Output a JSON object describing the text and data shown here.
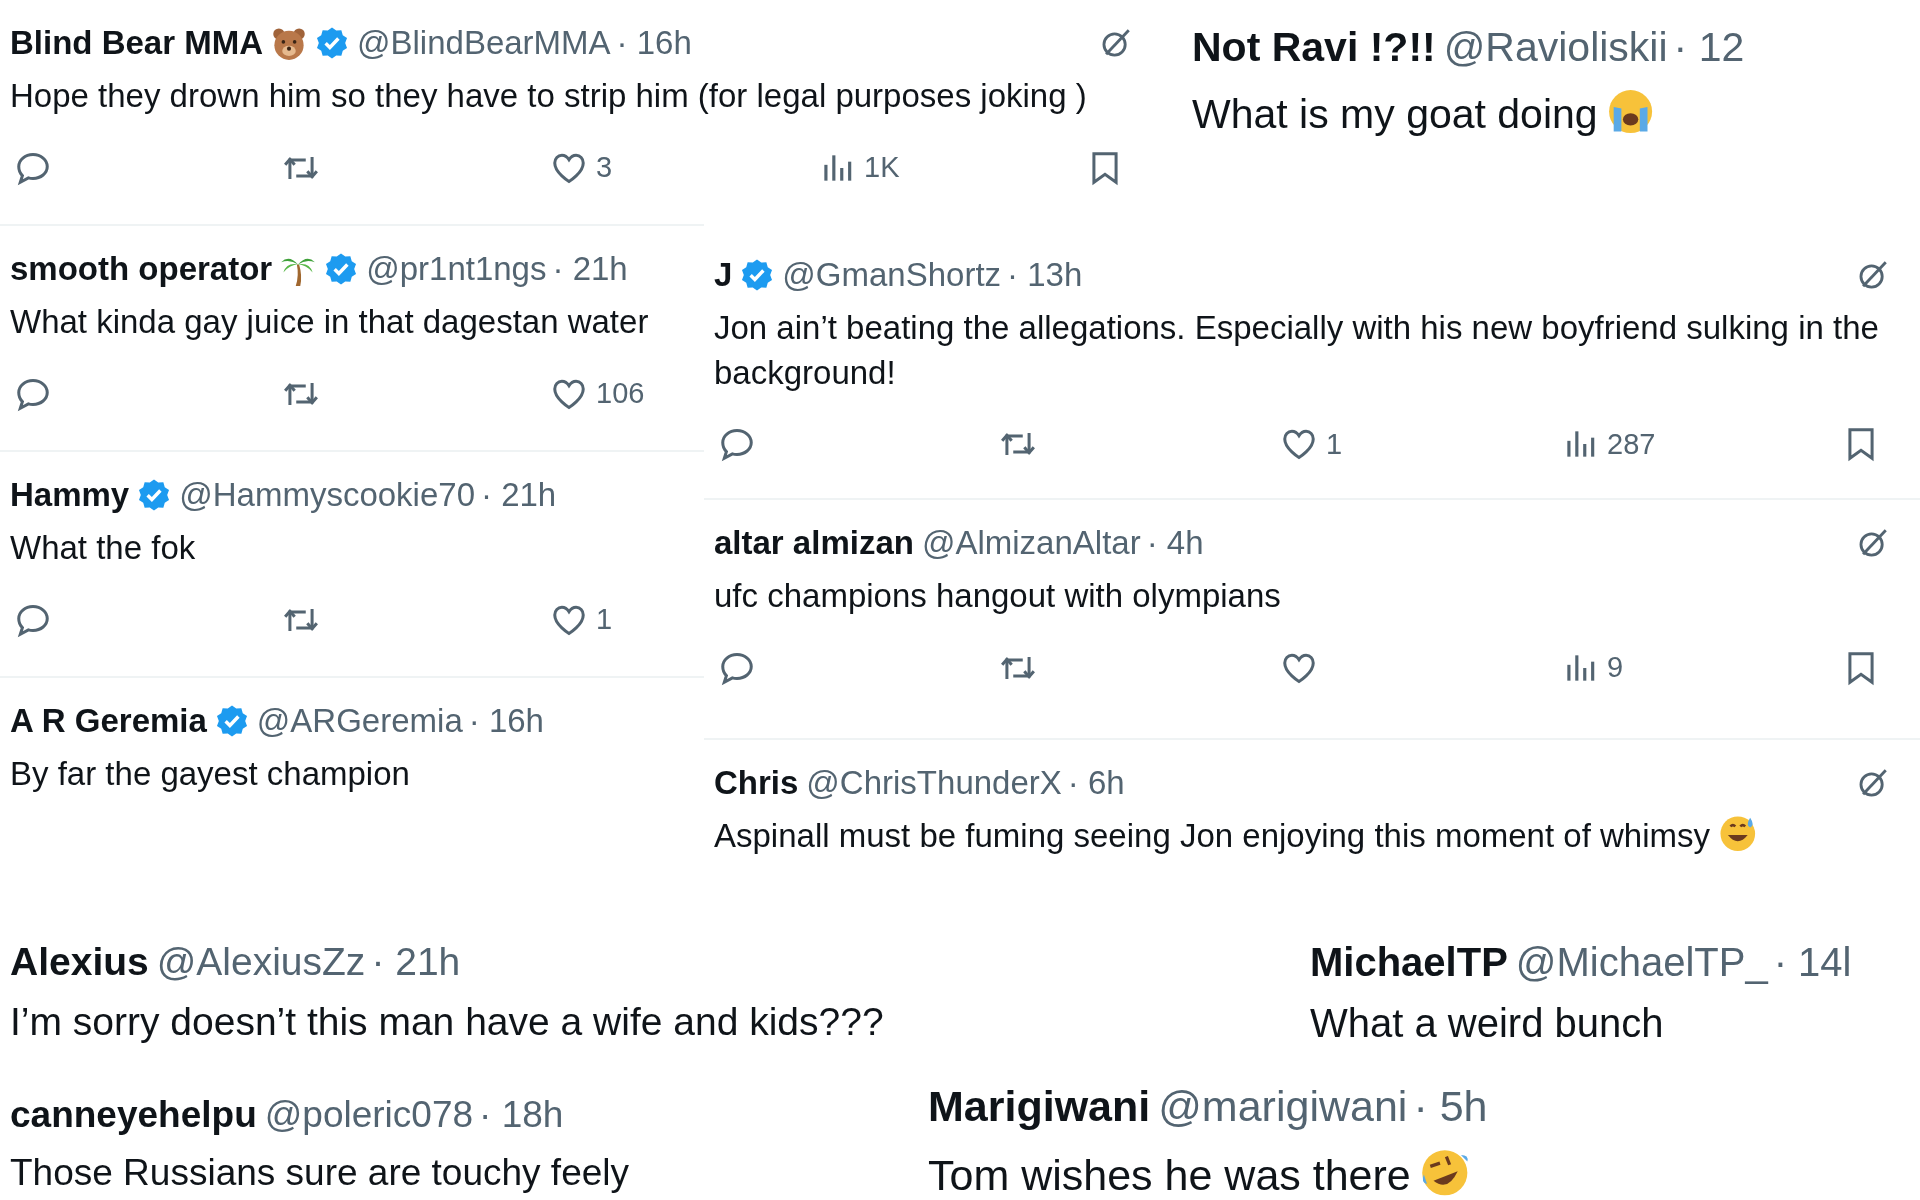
{
  "posts": [
    {
      "name": "Blind Bear MMA",
      "name_emoji": {
        "kind": "bear"
      },
      "verified": true,
      "handle": "@BlindBearMMA",
      "time": "· 16h",
      "grok": true,
      "text": "Hope they drown him so they have to strip him (for legal purposes joking )",
      "actions": [
        {
          "kind": "reply"
        },
        {
          "kind": "repost"
        },
        {
          "kind": "like",
          "count": "3"
        },
        {
          "kind": "views",
          "count": "1K"
        },
        {
          "kind": "bookmark"
        }
      ]
    },
    {
      "name": "Not Ravi !?!!",
      "verified": false,
      "handle": "@Ravioliskii",
      "time": "· 12",
      "grok": false,
      "text": "What is my goat doing",
      "text_emoji": {
        "kind": "crying"
      }
    },
    {
      "name": "smooth operator",
      "name_emoji": {
        "kind": "palm"
      },
      "verified": true,
      "handle": "@pr1nt1ngs",
      "time": "· 21h",
      "grok": false,
      "text": "What kinda gay juice in that dagestan water",
      "actions": [
        {
          "kind": "reply"
        },
        {
          "kind": "repost"
        },
        {
          "kind": "like",
          "count": "106"
        }
      ]
    },
    {
      "name": "J",
      "verified": true,
      "handle": "@GmanShortz",
      "time": "· 13h",
      "grok": true,
      "text": "Jon ain’t beating the allegations. Especially with his new boyfriend sulking in the background!",
      "actions": [
        {
          "kind": "reply"
        },
        {
          "kind": "repost"
        },
        {
          "kind": "like",
          "count": "1"
        },
        {
          "kind": "views",
          "count": "287"
        },
        {
          "kind": "bookmark"
        }
      ]
    },
    {
      "name": "Hammy",
      "verified": true,
      "handle": "@Hammyscookie70",
      "time": "· 21h",
      "grok": false,
      "text": "What the fok",
      "actions": [
        {
          "kind": "reply"
        },
        {
          "kind": "repost"
        },
        {
          "kind": "like",
          "count": "1"
        }
      ]
    },
    {
      "name": "altar almizan",
      "verified": false,
      "handle": "@AlmizanAltar",
      "time": "· 4h",
      "grok": true,
      "text": "ufc champions hangout with olympians",
      "actions": [
        {
          "kind": "reply"
        },
        {
          "kind": "repost"
        },
        {
          "kind": "like"
        },
        {
          "kind": "views",
          "count": "9"
        },
        {
          "kind": "bookmark"
        }
      ]
    },
    {
      "name": "A R Geremia",
      "verified": true,
      "handle": "@ARGeremia",
      "time": "· 16h",
      "grok": false,
      "text": "By far the gayest champion"
    },
    {
      "name": "Chris",
      "verified": false,
      "handle": "@ChrisThunderX",
      "time": "· 6h",
      "grok": true,
      "text": "Aspinall must be fuming seeing Jon enjoying this moment of whimsy",
      "text_emoji": {
        "kind": "sweat"
      }
    },
    {
      "name": "Alexius",
      "verified": false,
      "handle": "@AlexiusZz",
      "time": "· 21h",
      "grok": false,
      "text": "I’m sorry doesn’t this man have a wife and kids???"
    },
    {
      "name": "MichaelTP",
      "verified": false,
      "handle": "@MichaelTP_",
      "time": "· 14l",
      "grok": false,
      "text": "What a weird bunch"
    },
    {
      "name": "canneyehelpu",
      "verified": false,
      "handle": "@poleric078",
      "time": "· 18h",
      "grok": false,
      "text": "Those Russians sure are touchy feely"
    },
    {
      "name": "Marigiwani",
      "verified": false,
      "handle": "@marigiwani",
      "time": "· 5h",
      "grok": false,
      "text": "Tom wishes he was there",
      "text_emoji": {
        "kind": "laugh"
      }
    }
  ]
}
